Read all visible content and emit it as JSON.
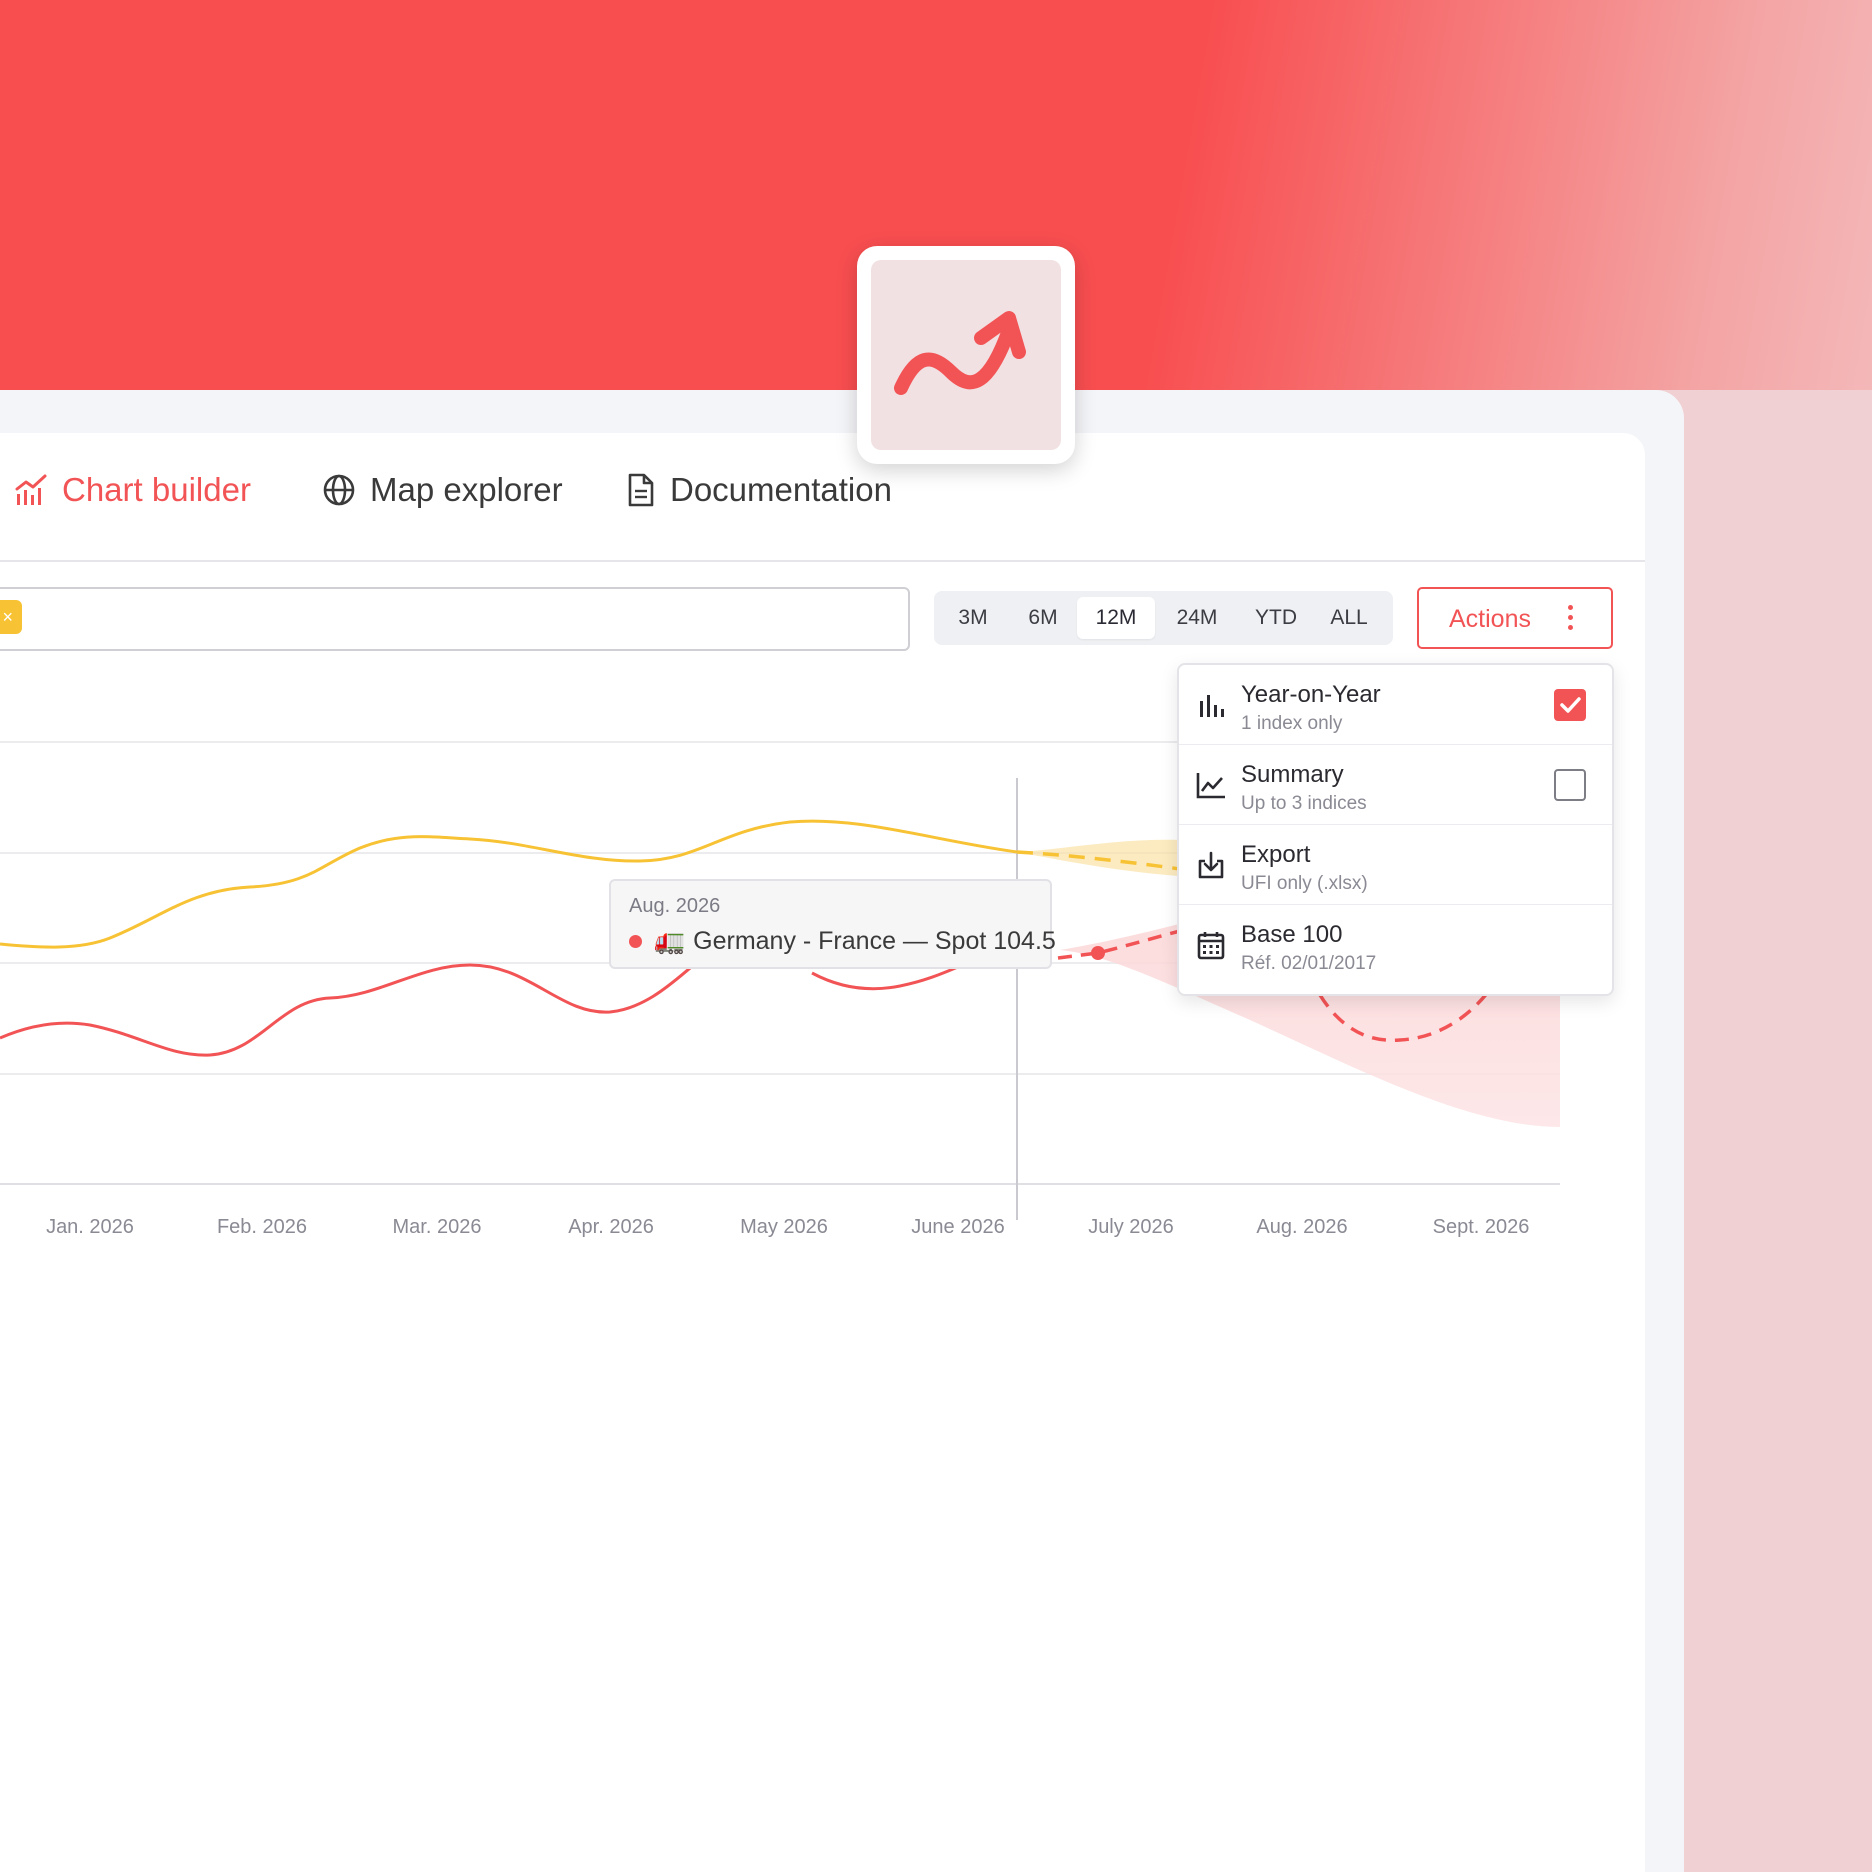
{
  "colors": {
    "accent": "#f25456",
    "series_yellow": "#f7c234",
    "series_red": "#f25456"
  },
  "logo": {
    "icon": "trend-arrow-icon"
  },
  "nav": {
    "items": [
      {
        "label": "Chart builder",
        "icon": "chart-icon",
        "active": true
      },
      {
        "label": "Map explorer",
        "icon": "globe-icon",
        "active": false
      },
      {
        "label": "Documentation",
        "icon": "document-icon",
        "active": false
      }
    ]
  },
  "search": {
    "chip_close": "×"
  },
  "ranges": {
    "options": [
      "3M",
      "6M",
      "12M",
      "24M",
      "YTD",
      "ALL"
    ],
    "selected": "12M"
  },
  "actions": {
    "label": "Actions",
    "menu": [
      {
        "title": "Year-on-Year",
        "subtitle": "1 index only",
        "icon": "bar-chart-icon",
        "checked": true
      },
      {
        "title": "Summary",
        "subtitle": "Up to 3 indices",
        "icon": "line-chart-icon",
        "checked": false
      },
      {
        "title": "Export",
        "subtitle": "UFI only (.xlsx)",
        "icon": "download-icon"
      },
      {
        "title": "Base 100",
        "subtitle": "Réf. 02/01/2017",
        "icon": "calendar-icon"
      }
    ]
  },
  "tooltip": {
    "date": "Aug. 2026",
    "emoji": "🚛",
    "text": "Germany - France — Spot 104.5"
  },
  "chart_data": {
    "type": "line",
    "x": [
      "Jan. 2026",
      "Feb. 2026",
      "Mar. 2026",
      "Apr. 2026",
      "May 2026",
      "June 2026",
      "July 2026",
      "Aug. 2026",
      "Sept. 2026"
    ],
    "grid": true,
    "series": [
      {
        "color": "#f7c234",
        "style": "solid then dashed forecast with confidence band"
      },
      {
        "color": "#f25456",
        "style": "solid then dashed forecast with confidence band"
      }
    ]
  }
}
